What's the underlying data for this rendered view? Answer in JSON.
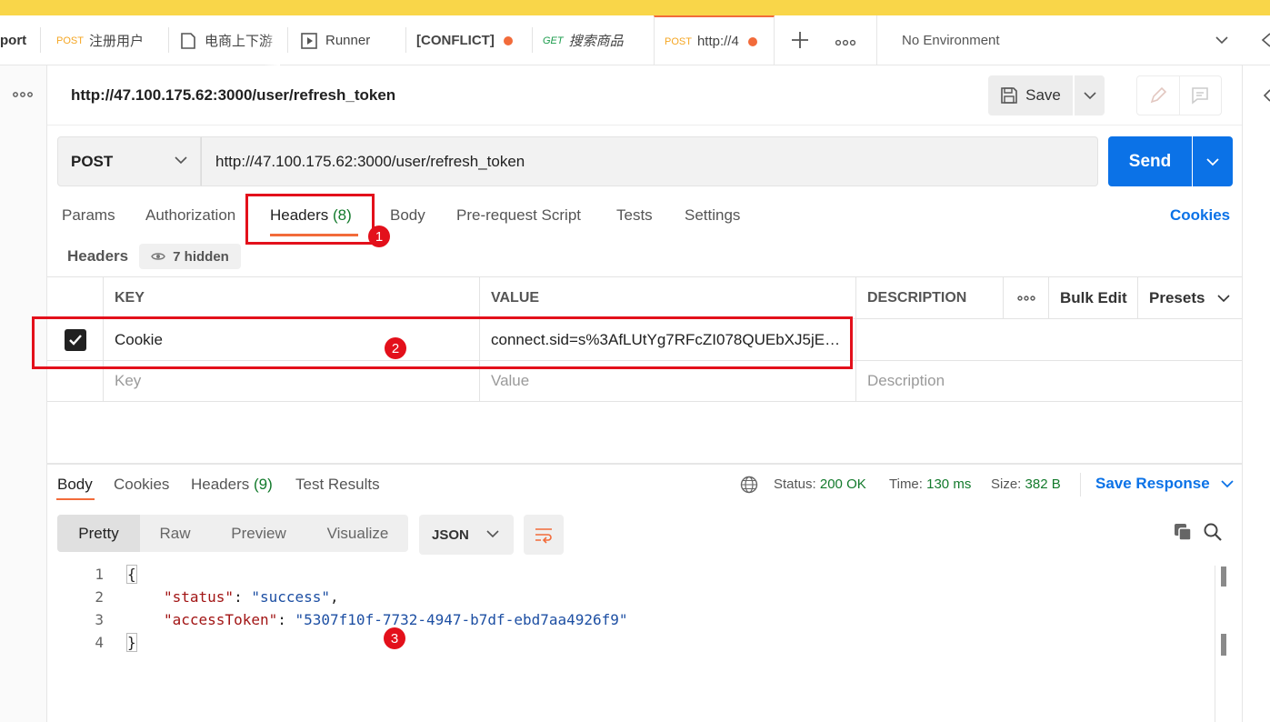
{
  "tabs": [
    {
      "label": "port",
      "method": ""
    },
    {
      "label": "注册用户",
      "method": "POST"
    },
    {
      "label": "电商上下游",
      "method": ""
    },
    {
      "label": "Runner",
      "method": ""
    },
    {
      "label": "[CONFLICT]",
      "method": ""
    },
    {
      "label": "搜索商品",
      "method": "GET"
    },
    {
      "label": "http://4",
      "method": "POST"
    }
  ],
  "environment": {
    "label": "No Environment"
  },
  "request": {
    "title": "http://47.100.175.62:3000/user/refresh_token",
    "method": "POST",
    "url": "http://47.100.175.62:3000/user/refresh_token",
    "save_label": "Save",
    "send_label": "Send"
  },
  "request_tabs": {
    "params": "Params",
    "authorization": "Authorization",
    "headers": "Headers",
    "headers_count": "(8)",
    "body": "Body",
    "prerequest": "Pre-request Script",
    "tests": "Tests",
    "settings": "Settings",
    "cookies": "Cookies"
  },
  "headers_panel": {
    "label": "Headers",
    "hidden": "7 hidden",
    "columns": {
      "key": "KEY",
      "value": "VALUE",
      "description": "DESCRIPTION",
      "bulk_edit": "Bulk Edit",
      "presets": "Presets"
    },
    "rows": [
      {
        "checked": true,
        "key": "Cookie",
        "value": "connect.sid=s%3AfLUtYg7RFcZI078QUEbXJ5jE…",
        "description": ""
      }
    ],
    "new_row": {
      "key": "Key",
      "value": "Value",
      "description": "Description"
    }
  },
  "annotations": [
    "1",
    "2",
    "3"
  ],
  "response": {
    "tabs": {
      "body": "Body",
      "cookies": "Cookies",
      "headers": "Headers",
      "headers_count": "(9)",
      "test_results": "Test Results"
    },
    "status_label": "Status:",
    "status": "200 OK",
    "time_label": "Time:",
    "time": "130 ms",
    "size_label": "Size:",
    "size": "382 B",
    "save_response": "Save Response",
    "views": {
      "pretty": "Pretty",
      "raw": "Raw",
      "preview": "Preview",
      "visualize": "Visualize"
    },
    "format": "JSON",
    "code": {
      "line_numbers": [
        "1",
        "2",
        "3",
        "4"
      ],
      "open": "{",
      "close": "}",
      "status_key": "\"status\"",
      "status_val": "\"success\"",
      "token_key": "\"accessToken\"",
      "token_val": "\"5307f10f-7732-4947-b7df-ebd7aa4926f9\""
    }
  },
  "colors": {
    "accent": "#f26b3a",
    "primary": "#0b72e7",
    "annotation": "#e3101b",
    "success": "#137a2c"
  }
}
